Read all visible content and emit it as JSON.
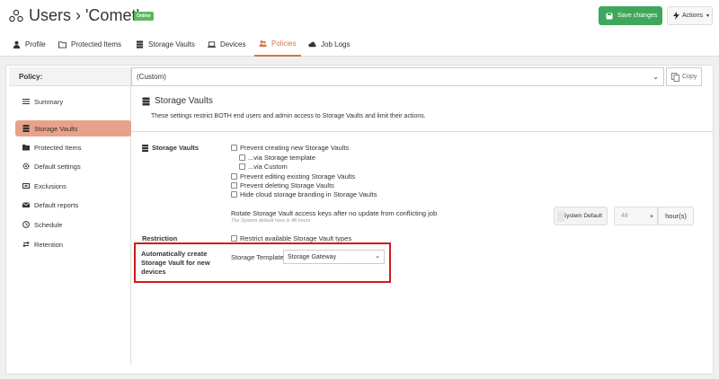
{
  "header": {
    "title": "Users › 'Comet'",
    "online_badge": "Online",
    "save_label": "Save changes",
    "actions_label": "Actions",
    "save_color": "#3fa75c"
  },
  "tabs": [
    {
      "label": "Profile",
      "icon": "user-icon"
    },
    {
      "label": "Protected Items",
      "icon": "folder-icon"
    },
    {
      "label": "Storage Vaults",
      "icon": "database-icon"
    },
    {
      "label": "Devices",
      "icon": "laptop-icon"
    },
    {
      "label": "Policies",
      "icon": "users-icon",
      "active": true
    },
    {
      "label": "Job Logs",
      "icon": "cloud-icon"
    }
  ],
  "policy": {
    "label": "Policy:",
    "selected": "(Custom)",
    "copy_label": "Copy"
  },
  "sidebar": {
    "items": [
      {
        "label": "Summary",
        "icon": "list-icon"
      },
      {
        "label": "Storage Vaults",
        "icon": "database-icon",
        "active": true
      },
      {
        "label": "Protected Items",
        "icon": "folder-icon"
      },
      {
        "label": "Default settings",
        "icon": "cog-icon"
      },
      {
        "label": "Exclusions",
        "icon": "exclusion-icon"
      },
      {
        "label": "Default reports",
        "icon": "envelope-icon"
      },
      {
        "label": "Schedule",
        "icon": "clock-icon"
      },
      {
        "label": "Retention",
        "icon": "retention-icon"
      }
    ],
    "active_color": "#e8a28a"
  },
  "main": {
    "section_title": "Storage Vaults",
    "section_desc": "These settings restrict BOTH end users and admin access to Storage Vaults and limit their actions.",
    "storage_vaults_label": "Storage Vaults",
    "checkboxes": [
      "Prevent creating new Storage Vaults",
      "...via Storage template",
      "...via Custom",
      "Prevent editing existing Storage Vaults",
      "Prevent deleting Storage Vaults",
      "Hide cloud storage branding in Storage Vaults"
    ],
    "rotate_text": "Rotate Storage Vault access keys after no update from conflicting job",
    "rotate_hint": "The System default here is 48 hours",
    "system_default_label": "System Default",
    "hours_value": "48",
    "hours_unit": "hour(s)",
    "restriction_label": "Restriction",
    "restriction_checkbox": "Restrict available Storage Vault types",
    "auto_create_label": "Automatically create Storage Vault for new devices",
    "storage_template_label": "Storage Template",
    "storage_template_value": "Storage Gateway",
    "highlight_color": "#d11a1a"
  }
}
